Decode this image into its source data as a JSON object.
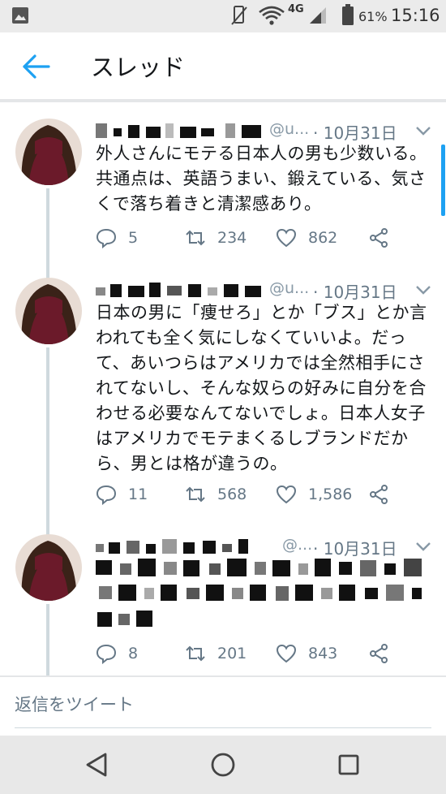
{
  "status_bar": {
    "network": "4G",
    "battery": "61%",
    "time": "15:16"
  },
  "header": {
    "title": "スレッド"
  },
  "tweets": [
    {
      "handle": "@u...",
      "date": "· 10月31日",
      "text": "外人さんにモテる日本人の男も少数いる。共通点は、英語うまい、鍛えている、気さくで落ち着きと清潔感あり。",
      "replies": "5",
      "retweets": "234",
      "likes": "862"
    },
    {
      "handle": "@u...",
      "date": "· 10月31日",
      "text": "日本の男に「痩せろ」とか「ブス」とか言われても全く気にしなくていいよ。だって、あいつらはアメリカでは全然相手にされてないし、そんな奴らの好みに自分を合わせる必要なんてないでしょ。日本人女子はアメリカでモテまくるしブランドだから、男とは格が違うの。",
      "replies": "11",
      "retweets": "568",
      "likes": "1,586"
    },
    {
      "handle": "@...",
      "date": "· 10月31日",
      "text": "",
      "replies": "8",
      "retweets": "201",
      "likes": "843"
    }
  ],
  "reply": {
    "placeholder": "返信をツイート"
  },
  "colors": {
    "accent": "#1da1f2",
    "secondary_text": "#657786",
    "primary_text": "#14171a"
  },
  "icons": [
    "image-icon",
    "rotate-icon",
    "wifi-icon",
    "signal-icon",
    "battery-icon",
    "back-arrow-icon",
    "chevron-down-icon",
    "reply-icon",
    "retweet-icon",
    "like-icon",
    "share-icon",
    "nav-back-icon",
    "nav-home-icon",
    "nav-recents-icon"
  ]
}
